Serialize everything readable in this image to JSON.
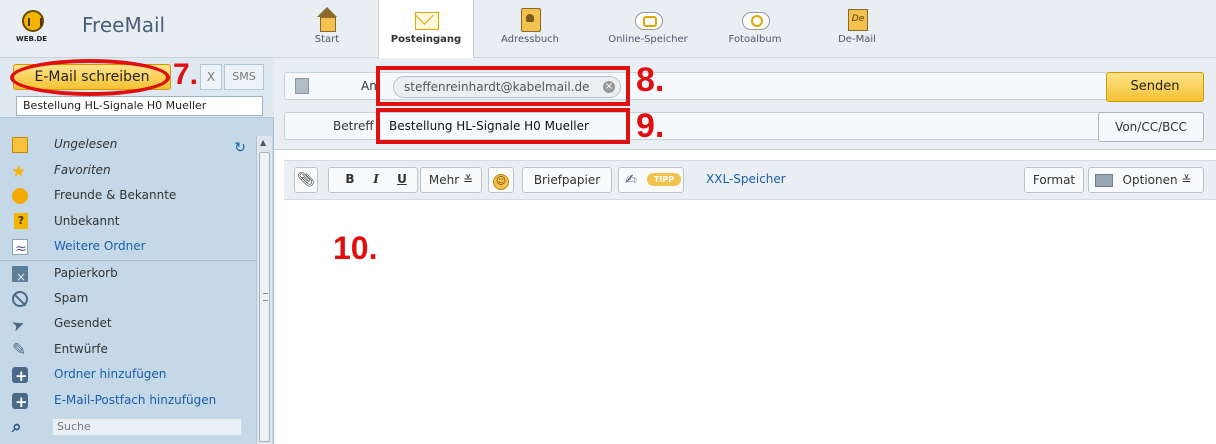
{
  "app": {
    "logo_text": "WEB.DE",
    "name": "FreeMail"
  },
  "nav": {
    "tabs": [
      {
        "label": "Start",
        "icon": "home-icon",
        "active": false
      },
      {
        "label": "Posteingang",
        "icon": "envelope-icon",
        "active": true
      },
      {
        "label": "Adressbuch",
        "icon": "address-book-icon",
        "active": false
      },
      {
        "label": "Online-Speicher",
        "icon": "cloud-icon",
        "active": false
      },
      {
        "label": "Fotoalbum",
        "icon": "camera-cloud-icon",
        "active": false
      },
      {
        "label": "De-Mail",
        "icon": "de-mail-icon",
        "active": false
      }
    ]
  },
  "sidebar": {
    "compose_label": "E-Mail schreiben",
    "fax_label": "X",
    "sms_label": "SMS",
    "draft_tab": "Bestellung HL-Signale H0 Mueller",
    "folders": [
      {
        "label": "Ungelesen",
        "icon": "envelope-icon",
        "style": "italic"
      },
      {
        "label": "Favoriten",
        "icon": "star-icon",
        "style": "italic"
      },
      {
        "label": "Freunde & Bekannte",
        "icon": "friends-icon",
        "style": "normal"
      },
      {
        "label": "Unbekannt",
        "icon": "unknown-icon",
        "style": "normal"
      },
      {
        "label": "Weitere Ordner",
        "icon": "more-folders-icon",
        "style": "blue"
      },
      {
        "label": "Papierkorb",
        "icon": "trash-icon",
        "style": "normal"
      },
      {
        "label": "Spam",
        "icon": "spam-icon",
        "style": "normal"
      },
      {
        "label": "Gesendet",
        "icon": "sent-icon",
        "style": "normal"
      },
      {
        "label": "Entwürfe",
        "icon": "drafts-icon",
        "style": "normal"
      },
      {
        "label": "Ordner hinzufügen",
        "icon": "plus-icon",
        "style": "blue"
      },
      {
        "label": "E-Mail-Postfach hinzufügen",
        "icon": "plus-icon",
        "style": "blue"
      }
    ],
    "search_placeholder": "Suche"
  },
  "compose": {
    "to_label": "An",
    "to_recipient": "steffenreinhardt@kabelmail.de",
    "subject_label": "Betreff",
    "subject_value": "Bestellung HL-Signale H0 Mueller",
    "send_label": "Senden",
    "cc_label": "Von/CC/BCC"
  },
  "toolbar": {
    "bold": "B",
    "italic": "I",
    "underline": "U",
    "more": "Mehr ≚",
    "stationery": "Briefpapier",
    "tipp": "TIPP",
    "xxl": "XXL-Speicher",
    "format": "Format",
    "options": "Optionen ≚"
  },
  "annotations": {
    "label_7": "7.",
    "label_8": "8.",
    "label_9": "9.",
    "label_10": "10.",
    "color": "#e01010"
  },
  "colors": {
    "accent_yellow": "#f4c233",
    "sidebar_blue": "#c5d8e8",
    "link_blue": "#1a5ea8"
  }
}
